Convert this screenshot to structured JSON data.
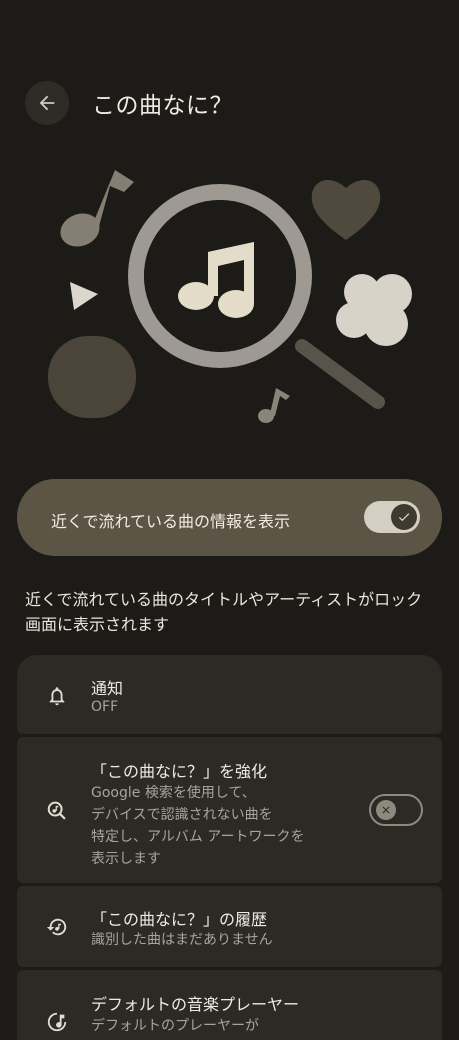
{
  "header": {
    "title": "この曲なに？",
    "back_icon": "arrow-left-icon"
  },
  "hero": {
    "icons": [
      "music-note-icon",
      "heart-icon",
      "play-icon",
      "magnifier-music-icon",
      "cloud-icon",
      "music-note-small-icon"
    ]
  },
  "main_toggle": {
    "label": "近くで流れている曲の情報を表示",
    "state": "on"
  },
  "description": "近くで流れている曲のタイトルやアーティストがロック画面に表示されます",
  "settings": {
    "notification": {
      "title": "通知",
      "subtitle": "OFF",
      "icon": "bell-icon"
    },
    "boost": {
      "title": "「この曲なに？」を強化",
      "subtitle_lines": [
        "Google 検索を使用して、",
        "デバイスで認識されない曲を",
        "特定し、アルバム アートワークを",
        "表示します"
      ],
      "icon": "music-search-icon",
      "state": "off"
    },
    "history": {
      "title": "「この曲なに？」の履歴",
      "subtitle": "識別した曲はまだありません",
      "icon": "history-music-icon"
    },
    "player": {
      "title": "デフォルトの音楽プレーヤー",
      "subtitle": "デフォルトのプレーヤーが",
      "icon": "music-player-icon"
    }
  },
  "colors": {
    "background": "#1c1b17",
    "toggle_bg": "#5c5545",
    "card_bg": "#2b2a25",
    "accent": "#d4cfc3"
  }
}
